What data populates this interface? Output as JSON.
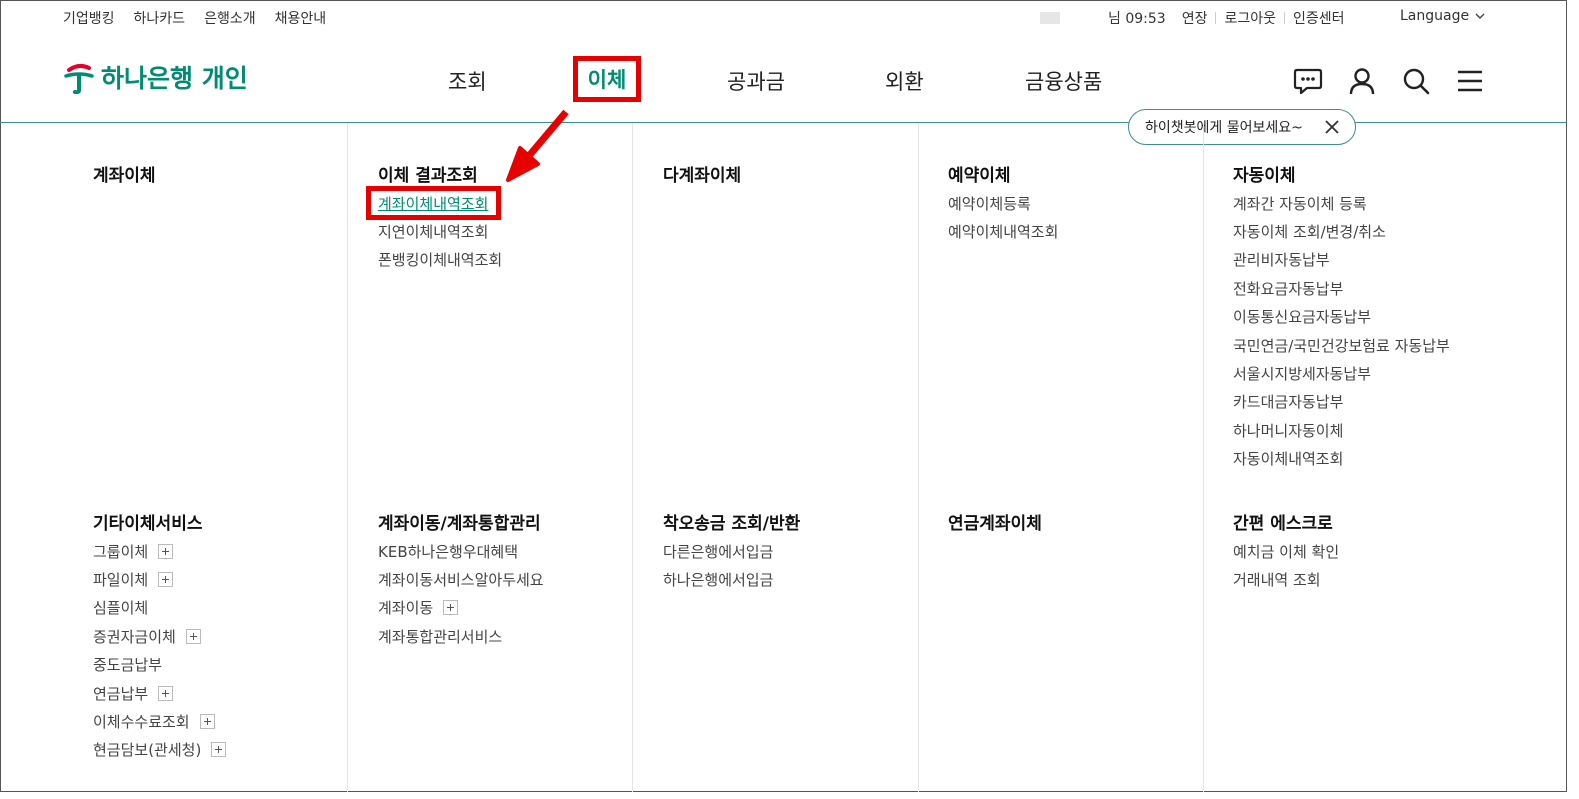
{
  "utility": {
    "links": [
      "기업뱅킹",
      "하나카드",
      "은행소개",
      "채용안내"
    ],
    "session": "님 09:53",
    "extend": "연장",
    "logout": "로그아웃",
    "cert": "인증센터",
    "language": "Language"
  },
  "header": {
    "logo": "하나은행 개인",
    "nav": [
      "조회",
      "이체",
      "공과금",
      "외환",
      "금융상품"
    ],
    "active_nav": "이체",
    "chatbot_tip": "하이챗봇에게 물어보세요~"
  },
  "menu": {
    "row1": [
      {
        "title": "계좌이체",
        "items": []
      },
      {
        "title": "이체 결과조회",
        "items": [
          "계좌이체내역조회",
          "지연이체내역조회",
          "폰뱅킹이체내역조회"
        ]
      },
      {
        "title": "다계좌이체",
        "items": []
      },
      {
        "title": "예약이체",
        "items": [
          "예약이체등록",
          "예약이체내역조회"
        ]
      },
      {
        "title": "자동이체",
        "items": [
          "계좌간 자동이체 등록",
          "자동이체 조회/변경/취소",
          "관리비자동납부",
          "전화요금자동납부",
          "이동통신요금자동납부",
          "국민연금/국민건강보험료 자동납부",
          "서울시지방세자동납부",
          "카드대금자동납부",
          "하나머니자동이체",
          "자동이체내역조회"
        ]
      }
    ],
    "row2": [
      {
        "title": "기타이체서비스",
        "items": [
          "그룹이체",
          "파일이체",
          "심플이체",
          "증권자금이체",
          "중도금납부",
          "연금납부",
          "이체수수료조회",
          "현금담보(관세청)"
        ],
        "plus": [
          true,
          true,
          false,
          true,
          false,
          true,
          true,
          true
        ]
      },
      {
        "title": "계좌이동/계좌통합관리",
        "items": [
          "KEB하나은행우대혜택",
          "계좌이동서비스알아두세요",
          "계좌이동",
          "계좌통합관리서비스"
        ],
        "plus": [
          false,
          false,
          true,
          false
        ]
      },
      {
        "title": "착오송금 조회/반환",
        "items": [
          "다른은행에서입금",
          "하나은행에서입금"
        ],
        "plus": [
          false,
          false
        ]
      },
      {
        "title": "연금계좌이체",
        "items": [],
        "plus": []
      },
      {
        "title": "간편 에스크로",
        "items": [
          "예치금 이체 확인",
          "거래내역 조회"
        ],
        "plus": [
          false,
          false
        ]
      }
    ]
  },
  "colors": {
    "brand": "#008c73",
    "highlight": "#e60000"
  }
}
